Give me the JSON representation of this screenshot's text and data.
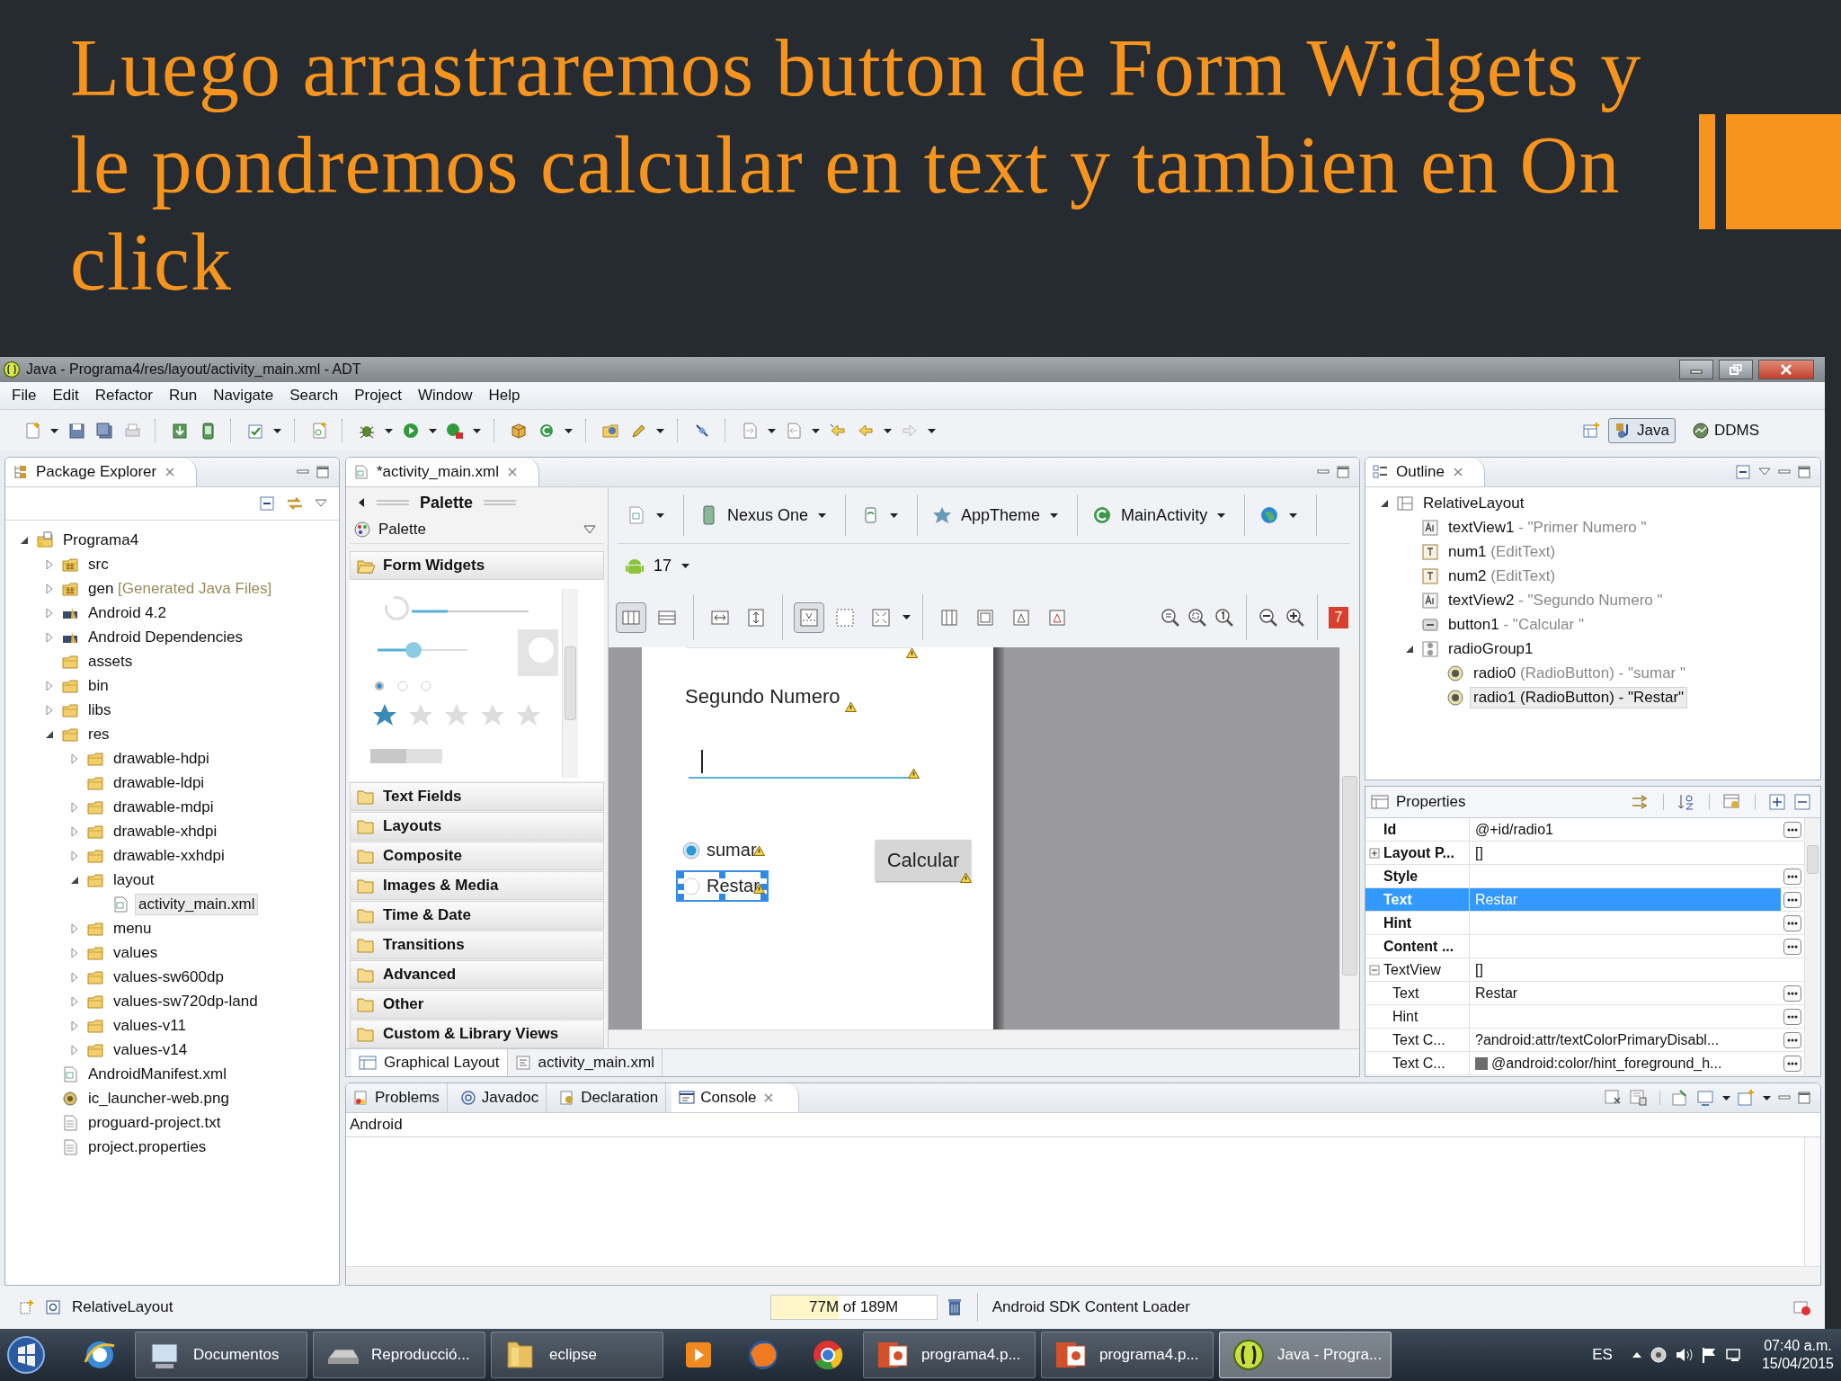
{
  "slide": {
    "title": "Luego arrastraremos button de Form Widgets y le pondremos calcular en text y tambien en On click"
  },
  "window": {
    "title": "Java - Programa4/res/layout/activity_main.xml - ADT"
  },
  "menu": [
    "File",
    "Edit",
    "Refactor",
    "Run",
    "Navigate",
    "Search",
    "Project",
    "Window",
    "Help"
  ],
  "perspectives": [
    {
      "label": "Java",
      "kind": "java",
      "selected": true
    },
    {
      "label": "DDMS",
      "kind": "ddms",
      "selected": false
    }
  ],
  "package_explorer": {
    "title": "Package Explorer",
    "tree": [
      {
        "label": "Programa4",
        "kind": "project",
        "expanded": true,
        "selected": false,
        "children": [
          {
            "label": "src",
            "kind": "source",
            "expanded": false,
            "selected": false
          },
          {
            "label": "gen",
            "note": " [Generated Java Files]",
            "kind": "source",
            "expanded": false,
            "selected": false
          },
          {
            "label": "Android 4.2",
            "kind": "library",
            "expanded": false,
            "selected": false
          },
          {
            "label": "Android Dependencies",
            "kind": "library",
            "expanded": false,
            "selected": false
          },
          {
            "label": "assets",
            "kind": "folder",
            "selected": false
          },
          {
            "label": "bin",
            "kind": "folder",
            "expanded": false,
            "selected": false
          },
          {
            "label": "libs",
            "kind": "folder",
            "expanded": false,
            "selected": false
          },
          {
            "label": "res",
            "kind": "folder",
            "expanded": true,
            "selected": false,
            "children": [
              {
                "label": "drawable-hdpi",
                "kind": "folder",
                "expanded": false,
                "selected": false
              },
              {
                "label": "drawable-ldpi",
                "kind": "folder",
                "selected": false
              },
              {
                "label": "drawable-mdpi",
                "kind": "folder",
                "expanded": false,
                "selected": false
              },
              {
                "label": "drawable-xhdpi",
                "kind": "folder",
                "expanded": false,
                "selected": false
              },
              {
                "label": "drawable-xxhdpi",
                "kind": "folder",
                "expanded": false,
                "selected": false
              },
              {
                "label": "layout",
                "kind": "folder",
                "expanded": true,
                "selected": false,
                "children": [
                  {
                    "label": "activity_main.xml",
                    "kind": "xml",
                    "selected": true
                  }
                ]
              },
              {
                "label": "menu",
                "kind": "folder",
                "expanded": false,
                "selected": false
              },
              {
                "label": "values",
                "kind": "folder",
                "expanded": false,
                "selected": false
              },
              {
                "label": "values-sw600dp",
                "kind": "folder",
                "expanded": false,
                "selected": false
              },
              {
                "label": "values-sw720dp-land",
                "kind": "folder",
                "expanded": false,
                "selected": false
              },
              {
                "label": "values-v11",
                "kind": "folder",
                "expanded": false,
                "selected": false
              },
              {
                "label": "values-v14",
                "kind": "folder",
                "expanded": false,
                "selected": false
              }
            ]
          },
          {
            "label": "AndroidManifest.xml",
            "kind": "xml",
            "selected": false
          },
          {
            "label": "ic_launcher-web.png",
            "kind": "image",
            "selected": false
          },
          {
            "label": "proguard-project.txt",
            "kind": "text",
            "selected": false
          },
          {
            "label": "project.properties",
            "kind": "text",
            "selected": false
          }
        ]
      }
    ]
  },
  "editor": {
    "tab": "*activity_main.xml",
    "palette": {
      "title": "Palette",
      "dropdown": "Palette",
      "groups": [
        {
          "label": "Form Widgets",
          "expanded": true
        },
        {
          "label": "Text Fields",
          "expanded": false
        },
        {
          "label": "Layouts",
          "expanded": false
        },
        {
          "label": "Composite",
          "expanded": false
        },
        {
          "label": "Images & Media",
          "expanded": false
        },
        {
          "label": "Time & Date",
          "expanded": false
        },
        {
          "label": "Transitions",
          "expanded": false
        },
        {
          "label": "Advanced",
          "expanded": false
        },
        {
          "label": "Other",
          "expanded": false
        },
        {
          "label": "Custom & Library Views",
          "expanded": false
        }
      ]
    },
    "config": {
      "device": "Nexus One",
      "theme": "AppTheme",
      "activity": "MainActivity",
      "api": "17",
      "errors": "7"
    },
    "canvas": {
      "label": "Segundo Numero",
      "radios": [
        {
          "label": "sumar",
          "selected": true,
          "focused": false
        },
        {
          "label": "Restar",
          "selected": false,
          "focused": true
        }
      ],
      "button": "Calcular"
    },
    "bottom_tabs": [
      {
        "label": "Graphical Layout",
        "kind": "graphical",
        "selected": true
      },
      {
        "label": "activity_main.xml",
        "kind": "xml",
        "selected": false
      }
    ]
  },
  "outline": {
    "title": "Outline",
    "tree": [
      {
        "name": "RelativeLayout",
        "kind": "layout",
        "expanded": true,
        "selected": false,
        "children": [
          {
            "name": "textView1",
            "detail": " - \"Primer Numero \"",
            "kind": "text",
            "selected": false
          },
          {
            "name": "num1",
            "detail": " (EditText)",
            "kind": "edit",
            "selected": false
          },
          {
            "name": "num2",
            "detail": " (EditText)",
            "kind": "edit",
            "selected": false
          },
          {
            "name": "textView2",
            "detail": " - \"Segundo Numero \"",
            "kind": "text",
            "selected": false
          },
          {
            "name": "button1",
            "detail": " - \"Calcular \"",
            "kind": "button",
            "selected": false
          },
          {
            "name": "radioGroup1",
            "kind": "group",
            "expanded": true,
            "selected": false,
            "children": [
              {
                "name": "radio0",
                "detail": " (RadioButton) - \"sumar \"",
                "kind": "radio",
                "selected": false
              },
              {
                "name": "radio1",
                "detail": " (RadioButton) - \"Restar\"",
                "kind": "radio",
                "selected": true
              }
            ]
          }
        ]
      }
    ]
  },
  "properties": {
    "title": "Properties",
    "rows": [
      {
        "name": "Id",
        "value": "@+id/radio1",
        "bold": true,
        "has_button": true,
        "selected": false
      },
      {
        "name": "Layout P...",
        "value": "[]",
        "bold": true,
        "has_button": false,
        "selected": false,
        "expanded": false
      },
      {
        "name": "Style",
        "bold": true,
        "has_button": true,
        "selected": false
      },
      {
        "name": "Text",
        "value": "Restar",
        "bold": true,
        "has_button": true,
        "selected": true
      },
      {
        "name": "Hint",
        "bold": true,
        "has_button": true,
        "selected": false
      },
      {
        "name": "Content ...",
        "bold": true,
        "has_button": true,
        "selected": false
      },
      {
        "name": "TextView",
        "value": "[]",
        "bold": false,
        "has_button": false,
        "selected": false,
        "expanded": true,
        "children": [
          {
            "name": "Text",
            "value": "Restar",
            "bold": false,
            "has_button": true,
            "selected": false
          },
          {
            "name": "Hint",
            "bold": false,
            "has_button": true,
            "selected": false
          },
          {
            "name": "Text C...",
            "value": "?android:attr/textColorPrimaryDisabl...",
            "bold": false,
            "has_button": true,
            "selected": false
          },
          {
            "name": "Text C...",
            "value": "@android:color/hint_foreground_h...",
            "color": "#6b6b6b",
            "bold": false,
            "has_button": true,
            "selected": false
          }
        ]
      }
    ]
  },
  "console": {
    "tabs": [
      {
        "label": "Problems",
        "kind": "problems",
        "selected": false
      },
      {
        "label": "Javadoc",
        "kind": "javadoc",
        "selected": false
      },
      {
        "label": "Declaration",
        "kind": "declaration",
        "selected": false
      },
      {
        "label": "Console",
        "kind": "console",
        "selected": true
      }
    ],
    "title": "Android"
  },
  "status_bar": {
    "selection": "RelativeLayout",
    "memory": {
      "text": "77M of 189M",
      "level": 0.41
    },
    "task": "Android SDK Content Loader"
  },
  "taskbar": {
    "items": [
      {
        "kind": "start",
        "selected": false
      },
      {
        "kind": "ie",
        "selected": false
      },
      {
        "kind": "explorer",
        "label": "Documentos",
        "selected": false
      },
      {
        "kind": "media",
        "label": "Reproducció...",
        "selected": false
      },
      {
        "kind": "folder",
        "label": "eclipse",
        "selected": false
      },
      {
        "kind": "player",
        "selected": false
      },
      {
        "kind": "firefox",
        "selected": false
      },
      {
        "kind": "chrome",
        "selected": false
      },
      {
        "kind": "powerpoint",
        "label": "programa4.p...",
        "selected": false
      },
      {
        "kind": "powerpoint",
        "label": "programa4.p...",
        "selected": false
      },
      {
        "kind": "eclipse",
        "label": "Java - Progra...",
        "selected": true
      }
    ],
    "language": "ES",
    "time": "07:40 a.m.",
    "date": "15/04/2015"
  }
}
